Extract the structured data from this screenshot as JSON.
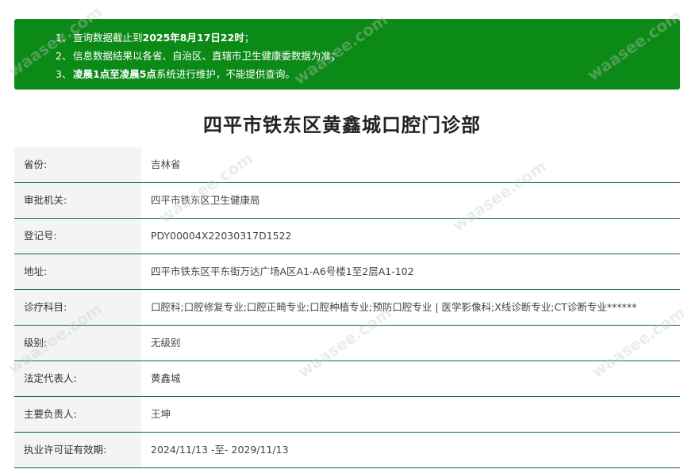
{
  "notice": {
    "lines": [
      {
        "num": "1、",
        "text_plain": "查询数据截止到",
        "text_bold": "2025年8月17日22时",
        "text_tail": "；"
      },
      {
        "num": "2、",
        "text_plain": "信息数据结果以各省、自治区、直辖市卫生健康委数据为准；",
        "text_bold": "",
        "text_tail": ""
      },
      {
        "num": "3、",
        "text_plain": "",
        "text_bold": "凌晨1点至凌晨5点",
        "text_tail": "系统进行维护，不能提供查询。"
      }
    ]
  },
  "title": "四平市铁东区黄鑫城口腔门诊部",
  "rows": [
    {
      "label": "省份:",
      "value": "吉林省"
    },
    {
      "label": "审批机关:",
      "value": "四平市铁东区卫生健康局"
    },
    {
      "label": "登记号:",
      "value": "PDY00004X22030317D1522"
    },
    {
      "label": "地址:",
      "value": "四平市铁东区平东街万达广场A区A1-A6号楼1至2层A1-102"
    },
    {
      "label": "诊疗科目:",
      "value": "口腔科;口腔修复专业;口腔正畸专业;口腔种植专业;预防口腔专业 | 医学影像科;X线诊断专业;CT诊断专业******"
    },
    {
      "label": "级别:",
      "value": "无级别"
    },
    {
      "label": "法定代表人:",
      "value": "黄鑫城"
    },
    {
      "label": "主要负责人:",
      "value": "王坤"
    },
    {
      "label": "执业许可证有效期:",
      "value": "2024/11/13 -至- 2029/11/13"
    }
  ],
  "watermark": "waasee.com",
  "colors": {
    "notice_bg": "#0c8a17",
    "row_border": "#0f6b3a",
    "label_bg": "#f4f4f4"
  }
}
